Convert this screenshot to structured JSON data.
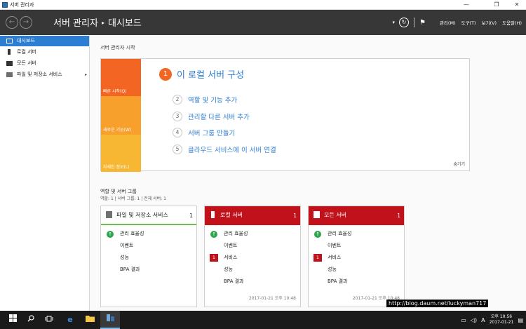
{
  "window": {
    "title": "서버 관리자",
    "buttons": {
      "minimize": "—",
      "restore": "❐",
      "close": "✕"
    }
  },
  "header": {
    "back_icon": "←",
    "forward_icon": "→",
    "breadcrumb_root": "서버 관리자",
    "breadcrumb_separator": "▸",
    "breadcrumb_current": "대시보드",
    "dropdown_icon": "▾",
    "refresh_icon": "↻",
    "flag_icon": "⚑",
    "menus": [
      "관리(M)",
      "도구(T)",
      "보기(V)",
      "도움말(H)"
    ]
  },
  "sidebar": {
    "items": [
      {
        "label": "대시보드",
        "icon": "dashboard-icon",
        "active": true
      },
      {
        "label": "로컬 서버",
        "icon": "server-icon",
        "active": false
      },
      {
        "label": "모든 서버",
        "icon": "servers-icon",
        "active": false
      },
      {
        "label": "파일 및 저장소 서비스",
        "icon": "storage-icon",
        "active": false,
        "arrow": "▸"
      }
    ]
  },
  "welcome": {
    "heading": "서버 관리자 시작",
    "tiles": [
      "빠른 시작(Q)",
      "새로운 기능(W)",
      "자세한 정보(L)"
    ],
    "primary_step": {
      "num": "1",
      "label": "이 로컬 서버 구성"
    },
    "steps": [
      {
        "num": "2",
        "label": "역할 및 기능 추가"
      },
      {
        "num": "3",
        "label": "관리할 다른 서버 추가"
      },
      {
        "num": "4",
        "label": "서버 그룹 만들기"
      },
      {
        "num": "5",
        "label": "클라우드 서비스에 이 서버 연결"
      }
    ],
    "hide_link": "숨기기"
  },
  "roles": {
    "title": "역할 및 서버 그룹",
    "counts": "역할: 1  |  서버 그룹: 1  |  전체 서버: 1",
    "cards": [
      {
        "title": "파일 및 저장소 서비스",
        "count": "1",
        "status": "ok",
        "rows": [
          {
            "label": "관리 효율성",
            "badge": "↑",
            "badge_type": "ok"
          },
          {
            "label": "이벤트",
            "badge": "",
            "badge_type": ""
          },
          {
            "label": "성능",
            "badge": "",
            "badge_type": ""
          },
          {
            "label": "BPA 결과",
            "badge": "",
            "badge_type": ""
          }
        ],
        "timestamp": ""
      },
      {
        "title": "로컬 서버",
        "count": "1",
        "status": "alert",
        "rows": [
          {
            "label": "관리 효율성",
            "badge": "↑",
            "badge_type": "ok"
          },
          {
            "label": "이벤트",
            "badge": "",
            "badge_type": ""
          },
          {
            "label": "서비스",
            "badge": "1",
            "badge_type": "bad"
          },
          {
            "label": "성능",
            "badge": "",
            "badge_type": ""
          },
          {
            "label": "BPA 결과",
            "badge": "",
            "badge_type": ""
          }
        ],
        "timestamp": "2017-01-21 오후 10:48"
      },
      {
        "title": "모든 서버",
        "count": "1",
        "status": "alert",
        "rows": [
          {
            "label": "관리 효율성",
            "badge": "↑",
            "badge_type": "ok"
          },
          {
            "label": "이벤트",
            "badge": "",
            "badge_type": ""
          },
          {
            "label": "서비스",
            "badge": "1",
            "badge_type": "bad"
          },
          {
            "label": "성능",
            "badge": "",
            "badge_type": ""
          },
          {
            "label": "BPA 결과",
            "badge": "",
            "badge_type": ""
          }
        ],
        "timestamp": "2017-01-21 오후 10:48"
      }
    ]
  },
  "watermark": "http://blog.daum.net/luckyman717",
  "taskbar": {
    "start_icon": "windows-logo-icon",
    "search_icon": "search-icon",
    "task_view_icon": "task-view-icon",
    "edge_icon": "edge-icon",
    "explorer_icon": "folder-icon",
    "server_manager_icon": "server-manager-icon",
    "ime": "A",
    "time": "오후 10:56",
    "date": "2017-01-21"
  },
  "colors": {
    "header_bg": "#373737",
    "accent_blue": "#2c7ed3",
    "alert_red": "#c1121c",
    "ok_green": "#2da44e",
    "tile_orange": "#f26522",
    "tile_amber": "#f7a02c"
  }
}
